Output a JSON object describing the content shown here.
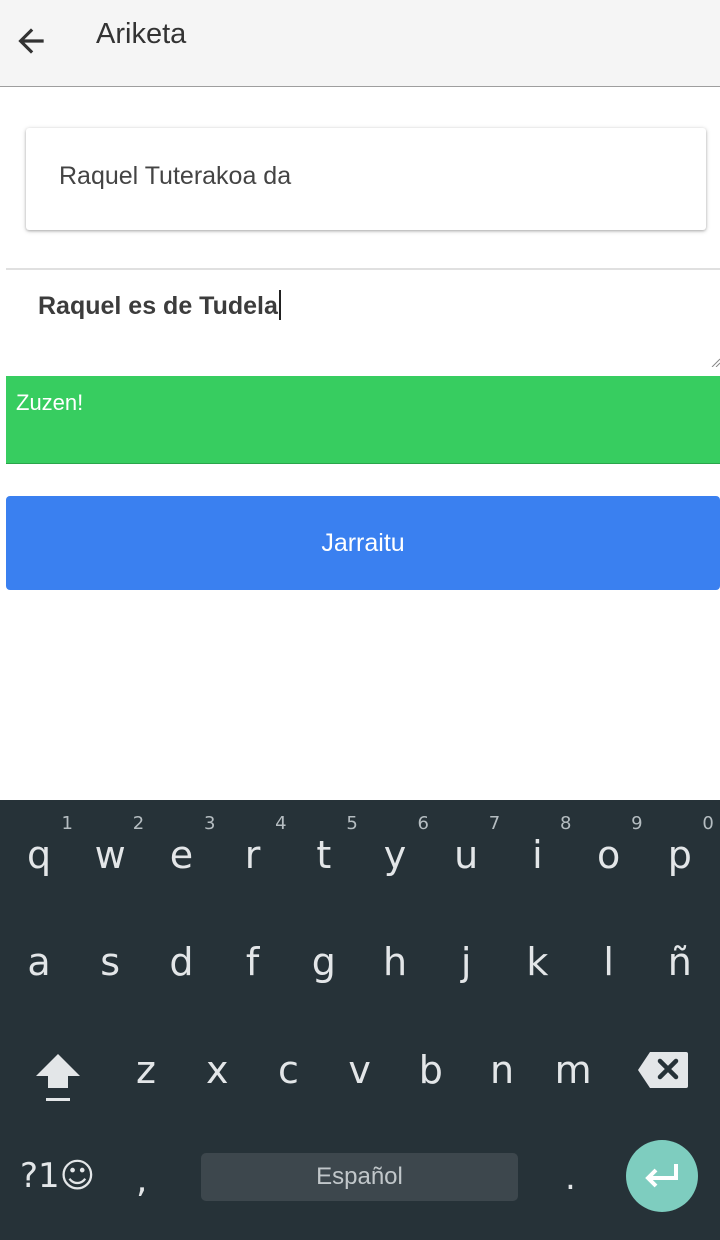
{
  "appbar": {
    "title": "Ariketa",
    "back_icon": "arrow-left-icon"
  },
  "prompt": {
    "text": "Raquel Tuterakoa da"
  },
  "answer": {
    "value": "Raquel es de Tudela"
  },
  "feedback": {
    "text": "Zuzen!",
    "color": "#37cd60"
  },
  "continue_button": {
    "label": "Jarraitu",
    "color": "#3a80f0"
  },
  "keyboard": {
    "background": "#263238",
    "row1": [
      {
        "key": "q",
        "hint": "1"
      },
      {
        "key": "w",
        "hint": "2"
      },
      {
        "key": "e",
        "hint": "3"
      },
      {
        "key": "r",
        "hint": "4"
      },
      {
        "key": "t",
        "hint": "5"
      },
      {
        "key": "y",
        "hint": "6"
      },
      {
        "key": "u",
        "hint": "7"
      },
      {
        "key": "i",
        "hint": "8"
      },
      {
        "key": "o",
        "hint": "9"
      },
      {
        "key": "p",
        "hint": "0"
      }
    ],
    "row2": [
      "a",
      "s",
      "d",
      "f",
      "g",
      "h",
      "j",
      "k",
      "l",
      "ñ"
    ],
    "row3": [
      "z",
      "x",
      "c",
      "v",
      "b",
      "n",
      "m"
    ],
    "symbols_label": "?1☺",
    "comma": ",",
    "space_label": "Español",
    "period": ".",
    "shift_icon": "shift-icon",
    "backspace_icon": "backspace-icon",
    "enter_icon": "enter-icon",
    "enter_color": "#7ecdbf"
  }
}
